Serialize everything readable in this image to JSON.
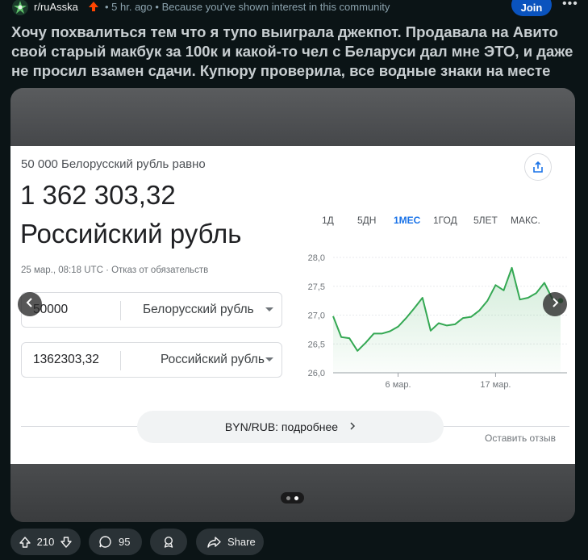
{
  "post": {
    "subreddit": "r/ruAsska",
    "time": "5 hr. ago",
    "reason": "Because you've shown interest in this community",
    "join_label": "Join",
    "more_label": "•••",
    "title": "Хочу похвалиться тем что я тупо выиграла джекпот. Продавала на Авито свой старый макбук за 100к и какой-то чел с Беларуси дал мне ЭТО, и даже не просил взамен сдачи. Купюру проверила, все водные знаки на месте"
  },
  "converter": {
    "equals_label": "50 000 Белорусский рубль равно",
    "result_value": "1 362 303,32",
    "result_currency": "Российский рубль",
    "timestamp": "25 мар., 08:18 UTC · Отказ от обязательств",
    "from_amount": "50000",
    "from_currency": "Белорусский рубль",
    "to_amount": "1362303,32",
    "to_currency": "Российский рубль",
    "tabs": [
      "1Д",
      "5ДН",
      "1МЕС",
      "1ГОД",
      "5ЛЕТ",
      "МАКС."
    ],
    "active_tab": "1МЕС",
    "more_label": "BYN/RUB: подробнее",
    "feedback_label": "Оставить отзыв"
  },
  "actions": {
    "votes": "210",
    "comments": "95",
    "share_label": "Share"
  },
  "colors": {
    "accent": "#0a53be",
    "upvote": "#ff4500",
    "chart_line": "#34a853",
    "active_tab": "#1a73e8"
  },
  "chart_data": {
    "type": "line",
    "title": "",
    "xlabel": "",
    "ylabel": "",
    "ylim": [
      26.0,
      28.0
    ],
    "yticks": [
      "28,0",
      "27,5",
      "27,0",
      "26,5",
      "26,0"
    ],
    "xticks": [
      "6 мар.",
      "17 мар."
    ],
    "series": [
      {
        "values": [
          26.98,
          26.62,
          26.6,
          26.38,
          26.52,
          26.68,
          26.68,
          26.72,
          26.8,
          26.95,
          27.12,
          27.3,
          26.73,
          26.86,
          26.82,
          26.84,
          26.95,
          26.97,
          27.08,
          27.25,
          27.52,
          27.43,
          27.82,
          27.27,
          27.3,
          27.38,
          27.56,
          27.28,
          27.25
        ]
      }
    ]
  }
}
